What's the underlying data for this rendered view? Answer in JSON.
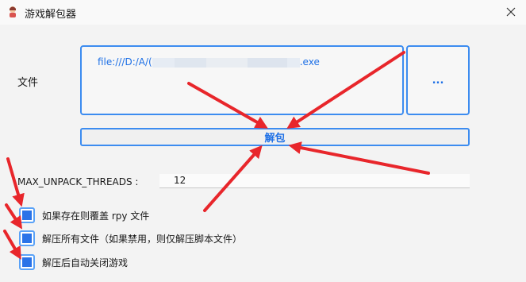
{
  "window": {
    "title": "游戏解包器",
    "app_icon": "app-icon",
    "close_icon": "close-icon"
  },
  "file": {
    "label": "文件",
    "path_prefix": "file:///D:/A/(",
    "path_suffix": ".exe",
    "browse_label": "..."
  },
  "unpack_button": "解包",
  "threads": {
    "label": "MAX_UNPACK_THREADS :",
    "value": "12"
  },
  "options": [
    {
      "label": "如果存在则覆盖 rpy 文件",
      "checked": true
    },
    {
      "label": "解压所有文件（如果禁用，则仅解压脚本文件）",
      "checked": true
    },
    {
      "label": "解压后自动关闭游戏",
      "checked": true
    }
  ],
  "colors": {
    "accent": "#3c8cf0",
    "accent_text": "#1e70e6",
    "annotation": "#e8262b"
  }
}
